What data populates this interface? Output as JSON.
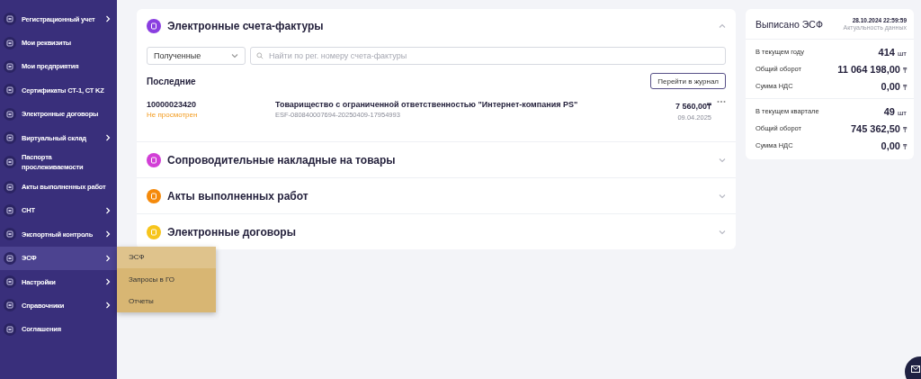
{
  "sidebar": {
    "items": [
      {
        "label": "Регистрационный учет",
        "has_submenu": true,
        "selected": false
      },
      {
        "label": "Мои реквизиты",
        "has_submenu": false,
        "selected": false
      },
      {
        "label": "Мои предприятия",
        "has_submenu": false,
        "selected": false
      },
      {
        "label": "Сертификаты СТ-1, СТ KZ",
        "has_submenu": false,
        "selected": false
      },
      {
        "label": "Электронные договоры",
        "has_submenu": false,
        "selected": false
      },
      {
        "label": "Виртуальный склад",
        "has_submenu": true,
        "selected": false
      },
      {
        "label": "Паспорта прослеживаемости",
        "has_submenu": false,
        "selected": false
      },
      {
        "label": "Акты выполненных работ",
        "has_submenu": false,
        "selected": false
      },
      {
        "label": "СНТ",
        "has_submenu": true,
        "selected": false
      },
      {
        "label": "Экспортный контроль",
        "has_submenu": true,
        "selected": false
      },
      {
        "label": "ЭСФ",
        "has_submenu": true,
        "selected": true,
        "submenu": [
          {
            "label": "ЭСФ",
            "selected": true
          },
          {
            "label": "Запросы в ГО",
            "selected": false
          },
          {
            "label": "Отчеты",
            "selected": false
          }
        ]
      },
      {
        "label": "Настройки",
        "has_submenu": true,
        "selected": false
      },
      {
        "label": "Справочники",
        "has_submenu": true,
        "selected": false
      },
      {
        "label": "Соглашения",
        "has_submenu": false,
        "selected": false
      }
    ]
  },
  "sections": [
    {
      "title": "Электронные счета-фактуры",
      "color": "#8a3ee0",
      "expanded": true,
      "filter": {
        "value": "Полученные"
      },
      "search": {
        "placeholder": "Найти по рег. номеру счета-фактуры"
      },
      "recent_title": "Последние",
      "journal_button": "Перейти в журнал",
      "rows": [
        {
          "number": "10000023420",
          "status": "Не просмотрен",
          "company": "Товарищество с ограниченной ответственностью \"Интернет-компания PS\"",
          "esf_id": "ESF-080840007694-20250409-17954993",
          "amount": "7 560,00₸",
          "date": "09.04.2025"
        }
      ]
    },
    {
      "title": "Сопроводительные накладные на товары",
      "color": "#d23fd6",
      "expanded": false
    },
    {
      "title": "Акты выполненных работ",
      "color": "#f58a0b",
      "expanded": false
    },
    {
      "title": "Электронные договоры",
      "color": "#f7c51c",
      "expanded": false
    }
  ],
  "summary": {
    "title": "Выписано ЭСФ",
    "timestamp": "28.10.2024 22:59:59",
    "timestamp_caption": "Актуальность данных",
    "groups": [
      {
        "rows": [
          {
            "label": "В текущем году",
            "value": "414",
            "unit": "шт"
          },
          {
            "label": "Общий оборот",
            "value": "11 064 198,00",
            "unit": "₸"
          },
          {
            "label": "Сумма НДС",
            "value": "0,00",
            "unit": "₸"
          }
        ]
      },
      {
        "rows": [
          {
            "label": "В текущем квартале",
            "value": "49",
            "unit": "шт"
          },
          {
            "label": "Общий оборот",
            "value": "745 362,50",
            "unit": "₸"
          },
          {
            "label": "Сумма НДС",
            "value": "0,00",
            "unit": "₸"
          }
        ]
      }
    ]
  }
}
